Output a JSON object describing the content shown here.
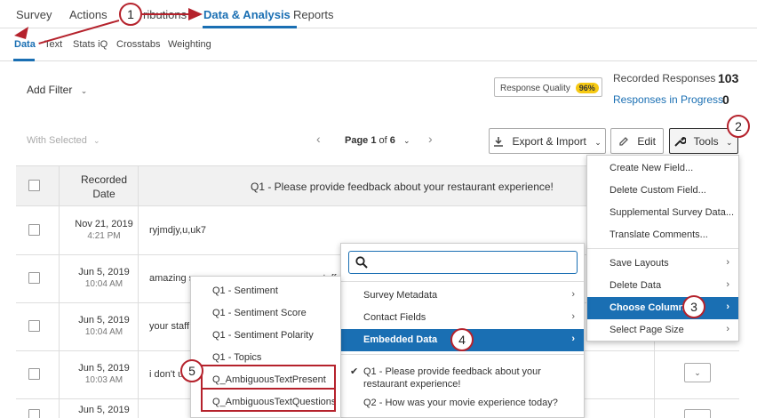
{
  "topnav": {
    "survey": "Survey",
    "actions": "Actions",
    "distributions_partial": "ributions",
    "data_analysis": "Data & Analysis",
    "reports": "Reports"
  },
  "subnav": {
    "data": "Data",
    "text": "Text",
    "stats_iq": "Stats iQ",
    "crosstabs": "Crosstabs",
    "weighting": "Weighting"
  },
  "filter": {
    "add_filter": "Add Filter",
    "chevron": "⌄"
  },
  "response_quality": {
    "label": "Response Quality",
    "badge": "96%"
  },
  "stats": {
    "recorded_label": "Recorded Responses",
    "recorded_value": "103",
    "in_progress_label": "Responses in Progress",
    "in_progress_value": "0"
  },
  "toolbar": {
    "with_selected": "With Selected",
    "page_prefix": "Page",
    "page_current": "1",
    "page_of": "of",
    "page_total": "6",
    "prev": "‹",
    "next": "›",
    "export_import": "Export & Import",
    "edit": "Edit",
    "tools": "Tools"
  },
  "table": {
    "header_date": "Recorded Date",
    "header_q1": "Q1 - Please provide feedback about your restaurant experience!",
    "rows": [
      {
        "date": "Nov 21, 2019",
        "time": "4:21 PM",
        "text": "ryjmdjy,u,uk7"
      },
      {
        "date": "Jun 5, 2019",
        "time": "10:04 AM",
        "text": "amazing s"
      },
      {
        "date": "Jun 5, 2019",
        "time": "10:04 AM",
        "text": "your staff"
      },
      {
        "date": "Jun 5, 2019",
        "time": "10:03 AM",
        "text": "i don't u"
      },
      {
        "date": "Jun 5, 2019",
        "time": "",
        "text": ""
      }
    ],
    "row2_extra": "staff"
  },
  "tools_menu": {
    "items": [
      {
        "label": "Create New Field..."
      },
      {
        "label": "Delete Custom Field..."
      },
      {
        "label": "Supplemental Survey Data..."
      },
      {
        "label": "Translate Comments..."
      },
      {
        "label": "Save Layouts"
      },
      {
        "label": "Delete Data"
      },
      {
        "label": "Choose Columns"
      },
      {
        "label": "Select Page Size"
      }
    ]
  },
  "columns_menu": {
    "search_placeholder": "",
    "items": [
      {
        "label": "Survey Metadata"
      },
      {
        "label": "Contact Fields"
      },
      {
        "label": "Embedded Data"
      },
      {
        "label": "Q1 - Please provide feedback about your restaurant experience!"
      },
      {
        "label": "Q2 - How was your movie experience today?"
      }
    ],
    "check": "✔"
  },
  "embedded_menu": {
    "items": [
      {
        "label": "Q1 - Sentiment"
      },
      {
        "label": "Q1 - Sentiment Score"
      },
      {
        "label": "Q1 - Sentiment Polarity"
      },
      {
        "label": "Q1 - Topics"
      },
      {
        "label": "Q_AmbiguousTextPresent"
      },
      {
        "label": "Q_AmbiguousTextQuestions"
      }
    ]
  },
  "callouts": [
    "1",
    "2",
    "3",
    "4",
    "5"
  ],
  "colors": {
    "accent": "#1a6fb3",
    "callout": "#b5222c",
    "badge": "#f6c913"
  }
}
